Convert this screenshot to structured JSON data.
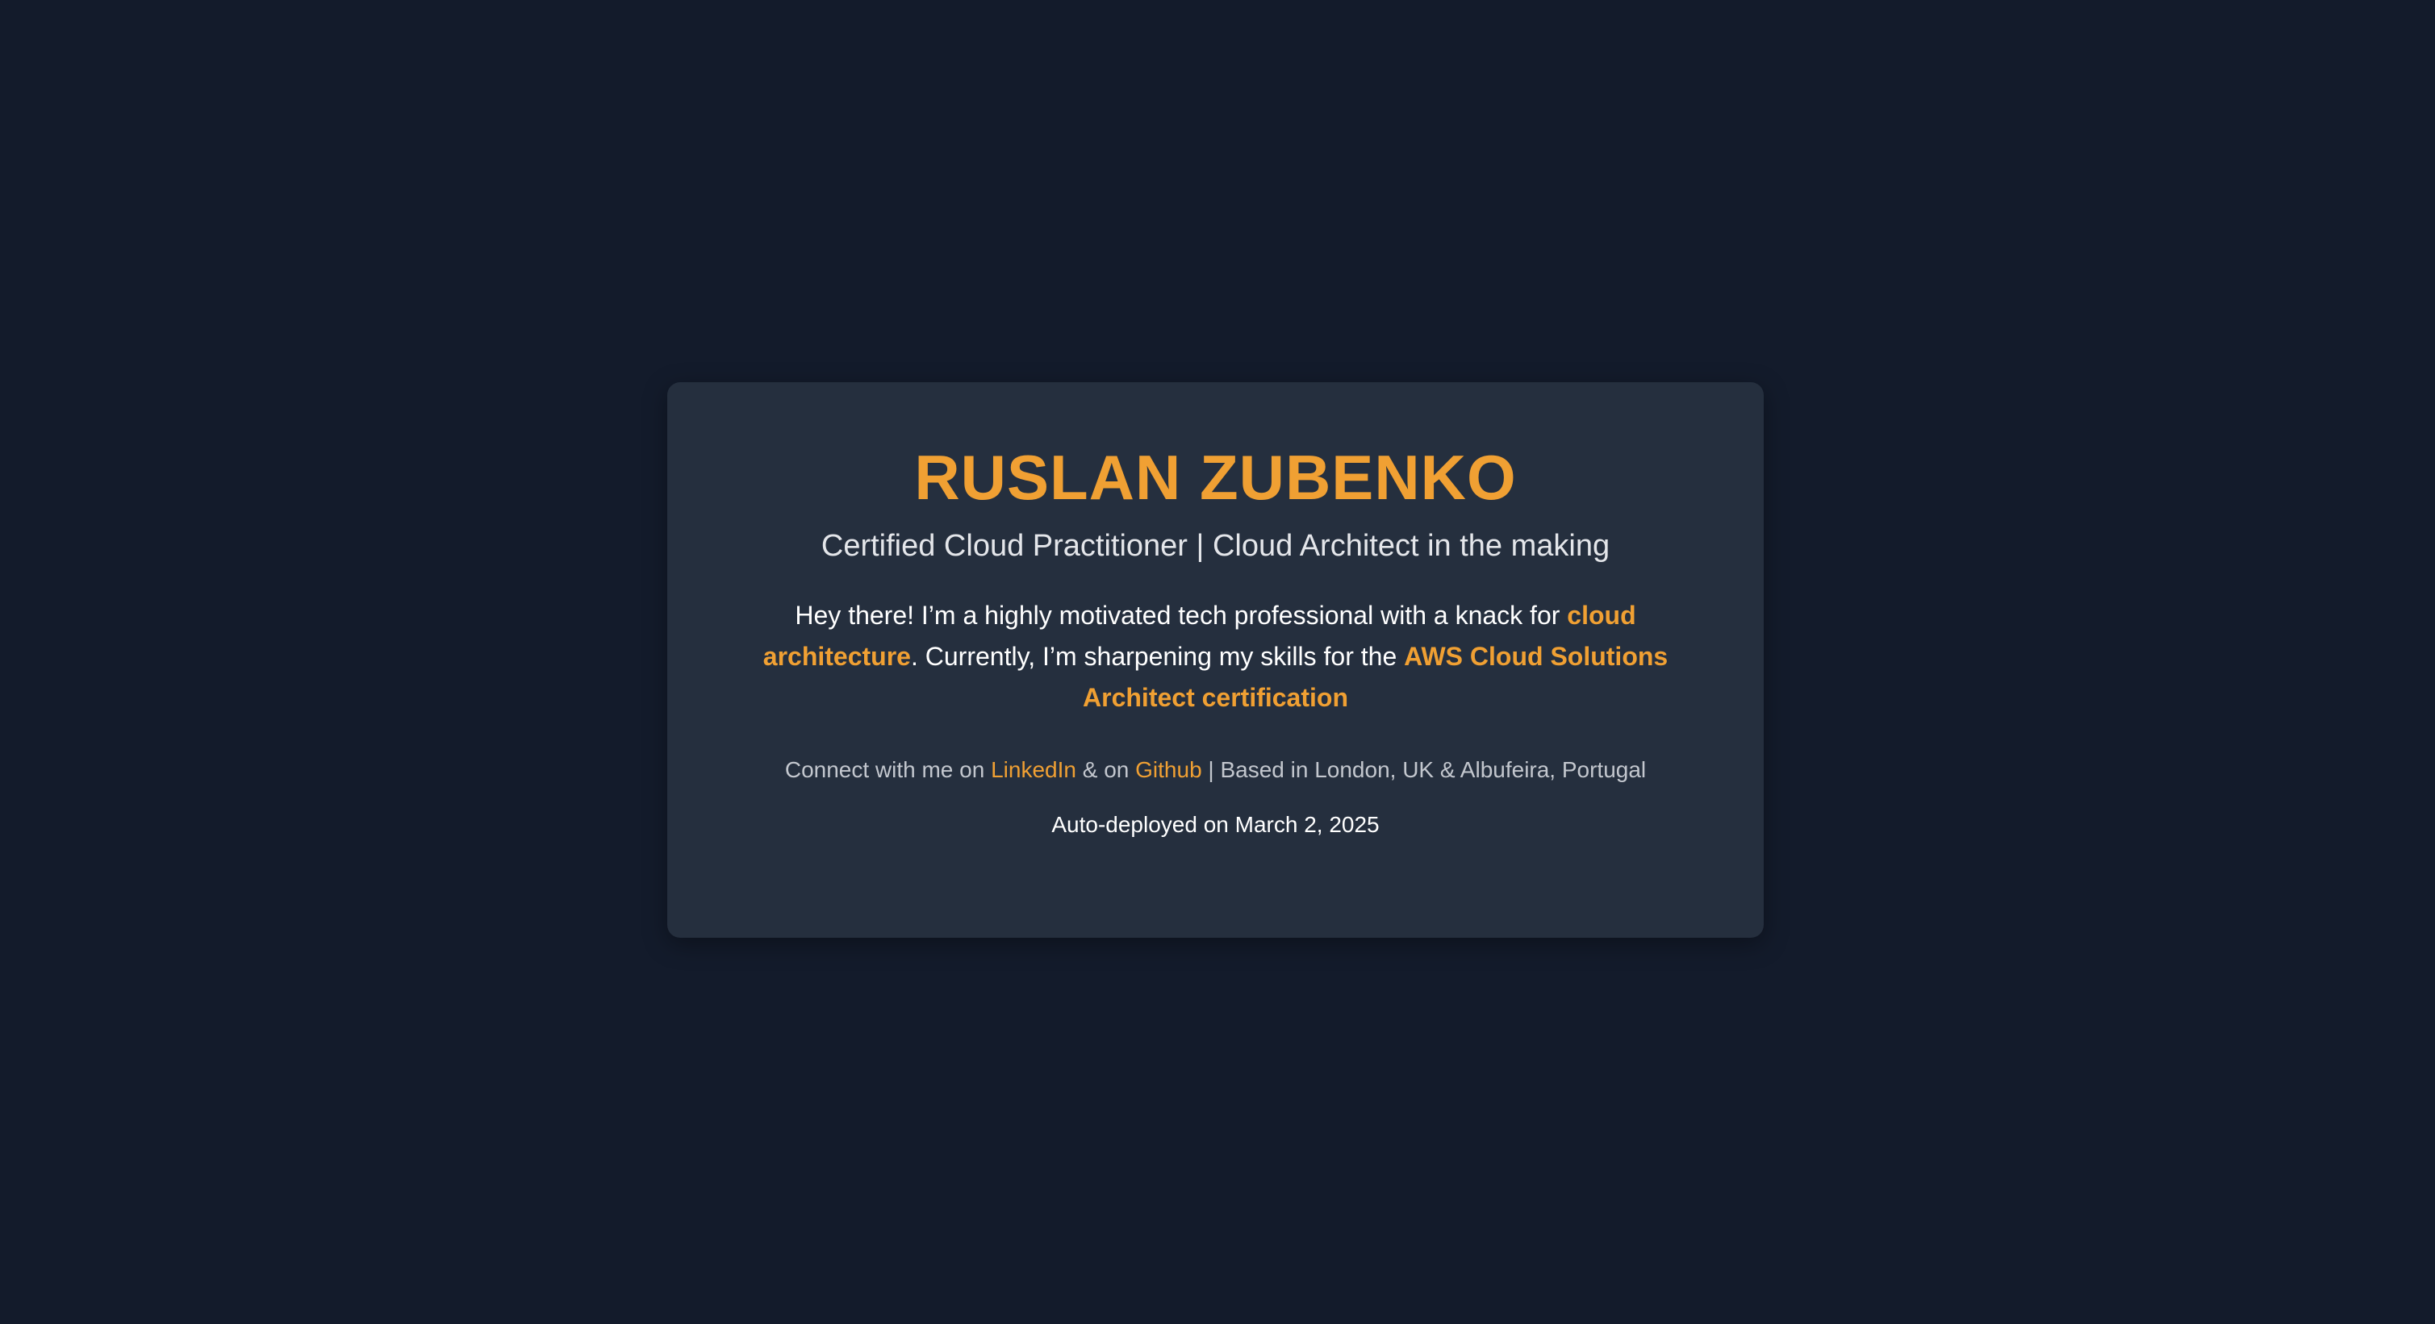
{
  "profile": {
    "name": "RUSLAN ZUBENKO",
    "subtitle": "Certified Cloud Practitioner | Cloud Architect in the making"
  },
  "intro": {
    "part1": "Hey there! I’m a highly motivated tech professional with a knack for ",
    "highlight1": "cloud architecture",
    "part2": ". Currently, I’m sharpening my skills for the ",
    "highlight2": "AWS Cloud Solutions Architect certification"
  },
  "connect": {
    "prefix": "Connect with me on ",
    "linkedin_label": "LinkedIn",
    "middle": " & on ",
    "github_label": "Github",
    "suffix": " | Based in London, UK & Albufeira, Portugal"
  },
  "deployed": "Auto-deployed on March 2, 2025",
  "colors": {
    "background": "#131b2b",
    "card": "#252f3e",
    "accent": "#f0a033",
    "text": "#ffffff",
    "muted": "#c3c7ce"
  }
}
